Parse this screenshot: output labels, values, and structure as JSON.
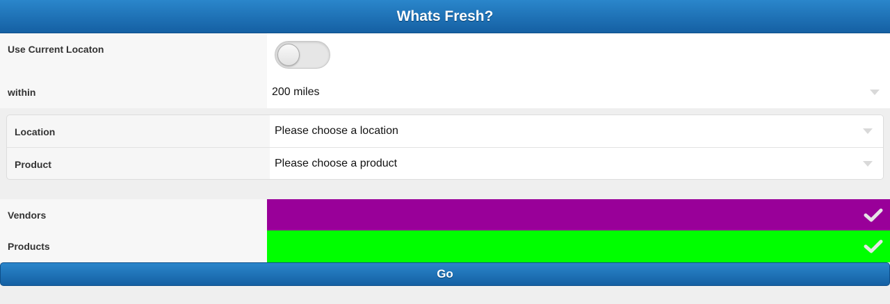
{
  "header": {
    "title": "Whats Fresh?"
  },
  "location_toggle": {
    "label": "Use Current Locaton",
    "state": "off"
  },
  "radius": {
    "label": "within",
    "selected": "200 miles"
  },
  "filters": {
    "location": {
      "label": "Location",
      "selected": "Please choose a location"
    },
    "product": {
      "label": "Product",
      "selected": "Please choose a product"
    }
  },
  "layers": {
    "vendors": {
      "label": "Vendors",
      "color": "#990099",
      "checked": true
    },
    "products": {
      "label": "Products",
      "color": "#00ff00",
      "checked": true
    }
  },
  "go_button": {
    "label": "Go"
  },
  "icons": {
    "dropdown": "chevron-down-icon",
    "check": "check-icon"
  }
}
